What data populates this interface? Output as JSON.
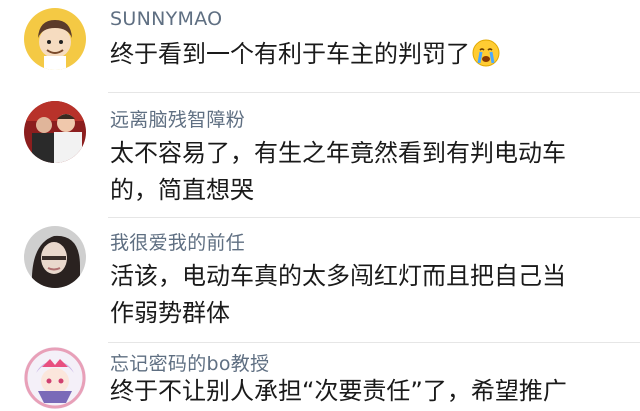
{
  "comments": [
    {
      "username": "SUNNYMAO",
      "lines": [
        "终于看到一个有利于车主的判罚了"
      ],
      "emoji": "crying-face-icon"
    },
    {
      "username": "远离脑残智障粉",
      "lines": [
        "太不容易了，有生之年竟然看到有判电动车",
        "的，简直想哭"
      ]
    },
    {
      "username": "我很爱我的前任",
      "lines": [
        "活该，电动车真的太多闯红灯而且把自己当",
        "作弱势群体"
      ]
    },
    {
      "username": "忘记密码的bo教授",
      "lines": [
        "终于不让别人承担“次要责任”了，希望推广"
      ]
    }
  ]
}
